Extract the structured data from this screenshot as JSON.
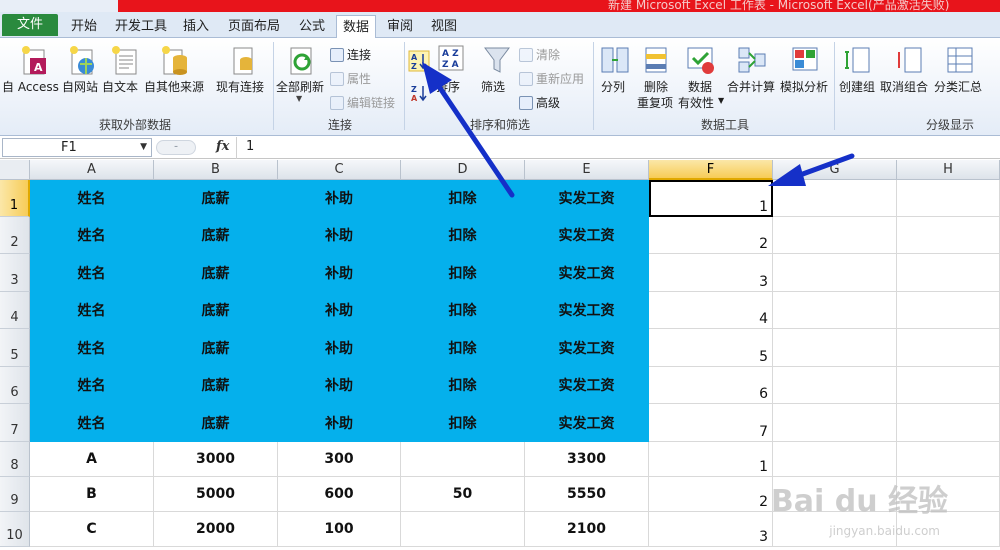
{
  "title_bar": {
    "title": "新建 Microsoft Excel 工作表 - Microsoft Excel(产品激活失败)"
  },
  "tabs": [
    {
      "label": "文件"
    },
    {
      "label": "开始"
    },
    {
      "label": "开发工具"
    },
    {
      "label": "插入"
    },
    {
      "label": "页面布局"
    },
    {
      "label": "公式"
    },
    {
      "label": "数据"
    },
    {
      "label": "审阅"
    },
    {
      "label": "视图"
    }
  ],
  "ribbon": {
    "get_external": {
      "label": "获取外部数据",
      "buttons": [
        "自 Access",
        "自网站",
        "自文本",
        "自其他来源",
        "现有连接"
      ]
    },
    "connections": {
      "label": "连接",
      "refresh_all": "全部刷新",
      "connections": "连接",
      "properties": "属性",
      "edit_links": "编辑链接"
    },
    "sort_filter": {
      "label": "排序和筛选",
      "sort": "排序",
      "filter": "筛选",
      "clear": "清除",
      "reapply": "重新应用",
      "advanced": "高级"
    },
    "data_tools": {
      "label": "数据工具",
      "split": "分列",
      "remove_dup_1": "删除",
      "remove_dup_2": "重复项",
      "validation_1": "数据",
      "validation_2": "有效性",
      "consolidate": "合并计算",
      "whatif": "模拟分析"
    },
    "outline": {
      "label": "分级显示",
      "group": "创建组",
      "ungroup": "取消组合",
      "subtotal": "分类汇总"
    }
  },
  "formula_bar": {
    "name_box": "F1",
    "fx": "fx",
    "value": "1"
  },
  "columns": [
    "A",
    "B",
    "C",
    "D",
    "E",
    "F",
    "G",
    "H"
  ],
  "rows": [
    {
      "n": "1",
      "cells": [
        "姓名",
        "底薪",
        "补助",
        "扣除",
        "实发工资"
      ],
      "f": "1"
    },
    {
      "n": "2",
      "cells": [
        "姓名",
        "底薪",
        "补助",
        "扣除",
        "实发工资"
      ],
      "f": "2"
    },
    {
      "n": "3",
      "cells": [
        "姓名",
        "底薪",
        "补助",
        "扣除",
        "实发工资"
      ],
      "f": "3"
    },
    {
      "n": "4",
      "cells": [
        "姓名",
        "底薪",
        "补助",
        "扣除",
        "实发工资"
      ],
      "f": "4"
    },
    {
      "n": "5",
      "cells": [
        "姓名",
        "底薪",
        "补助",
        "扣除",
        "实发工资"
      ],
      "f": "5"
    },
    {
      "n": "6",
      "cells": [
        "姓名",
        "底薪",
        "补助",
        "扣除",
        "实发工资"
      ],
      "f": "6"
    },
    {
      "n": "7",
      "cells": [
        "姓名",
        "底薪",
        "补助",
        "扣除",
        "实发工资"
      ],
      "f": "7"
    },
    {
      "n": "8",
      "cells": [
        "A",
        "3000",
        "300",
        "",
        "3300"
      ],
      "f": "1"
    },
    {
      "n": "9",
      "cells": [
        "B",
        "5000",
        "600",
        "50",
        "5550"
      ],
      "f": "2"
    },
    {
      "n": "10",
      "cells": [
        "C",
        "2000",
        "100",
        "",
        "2100"
      ],
      "f": "3"
    }
  ],
  "watermark": {
    "brand": "Bai du 经验",
    "url": "jingyan.baidu.com"
  },
  "colors": {
    "header_fill": "#05b0ec",
    "file_tab": "#2a8a3e",
    "arrow": "#1530c8"
  }
}
